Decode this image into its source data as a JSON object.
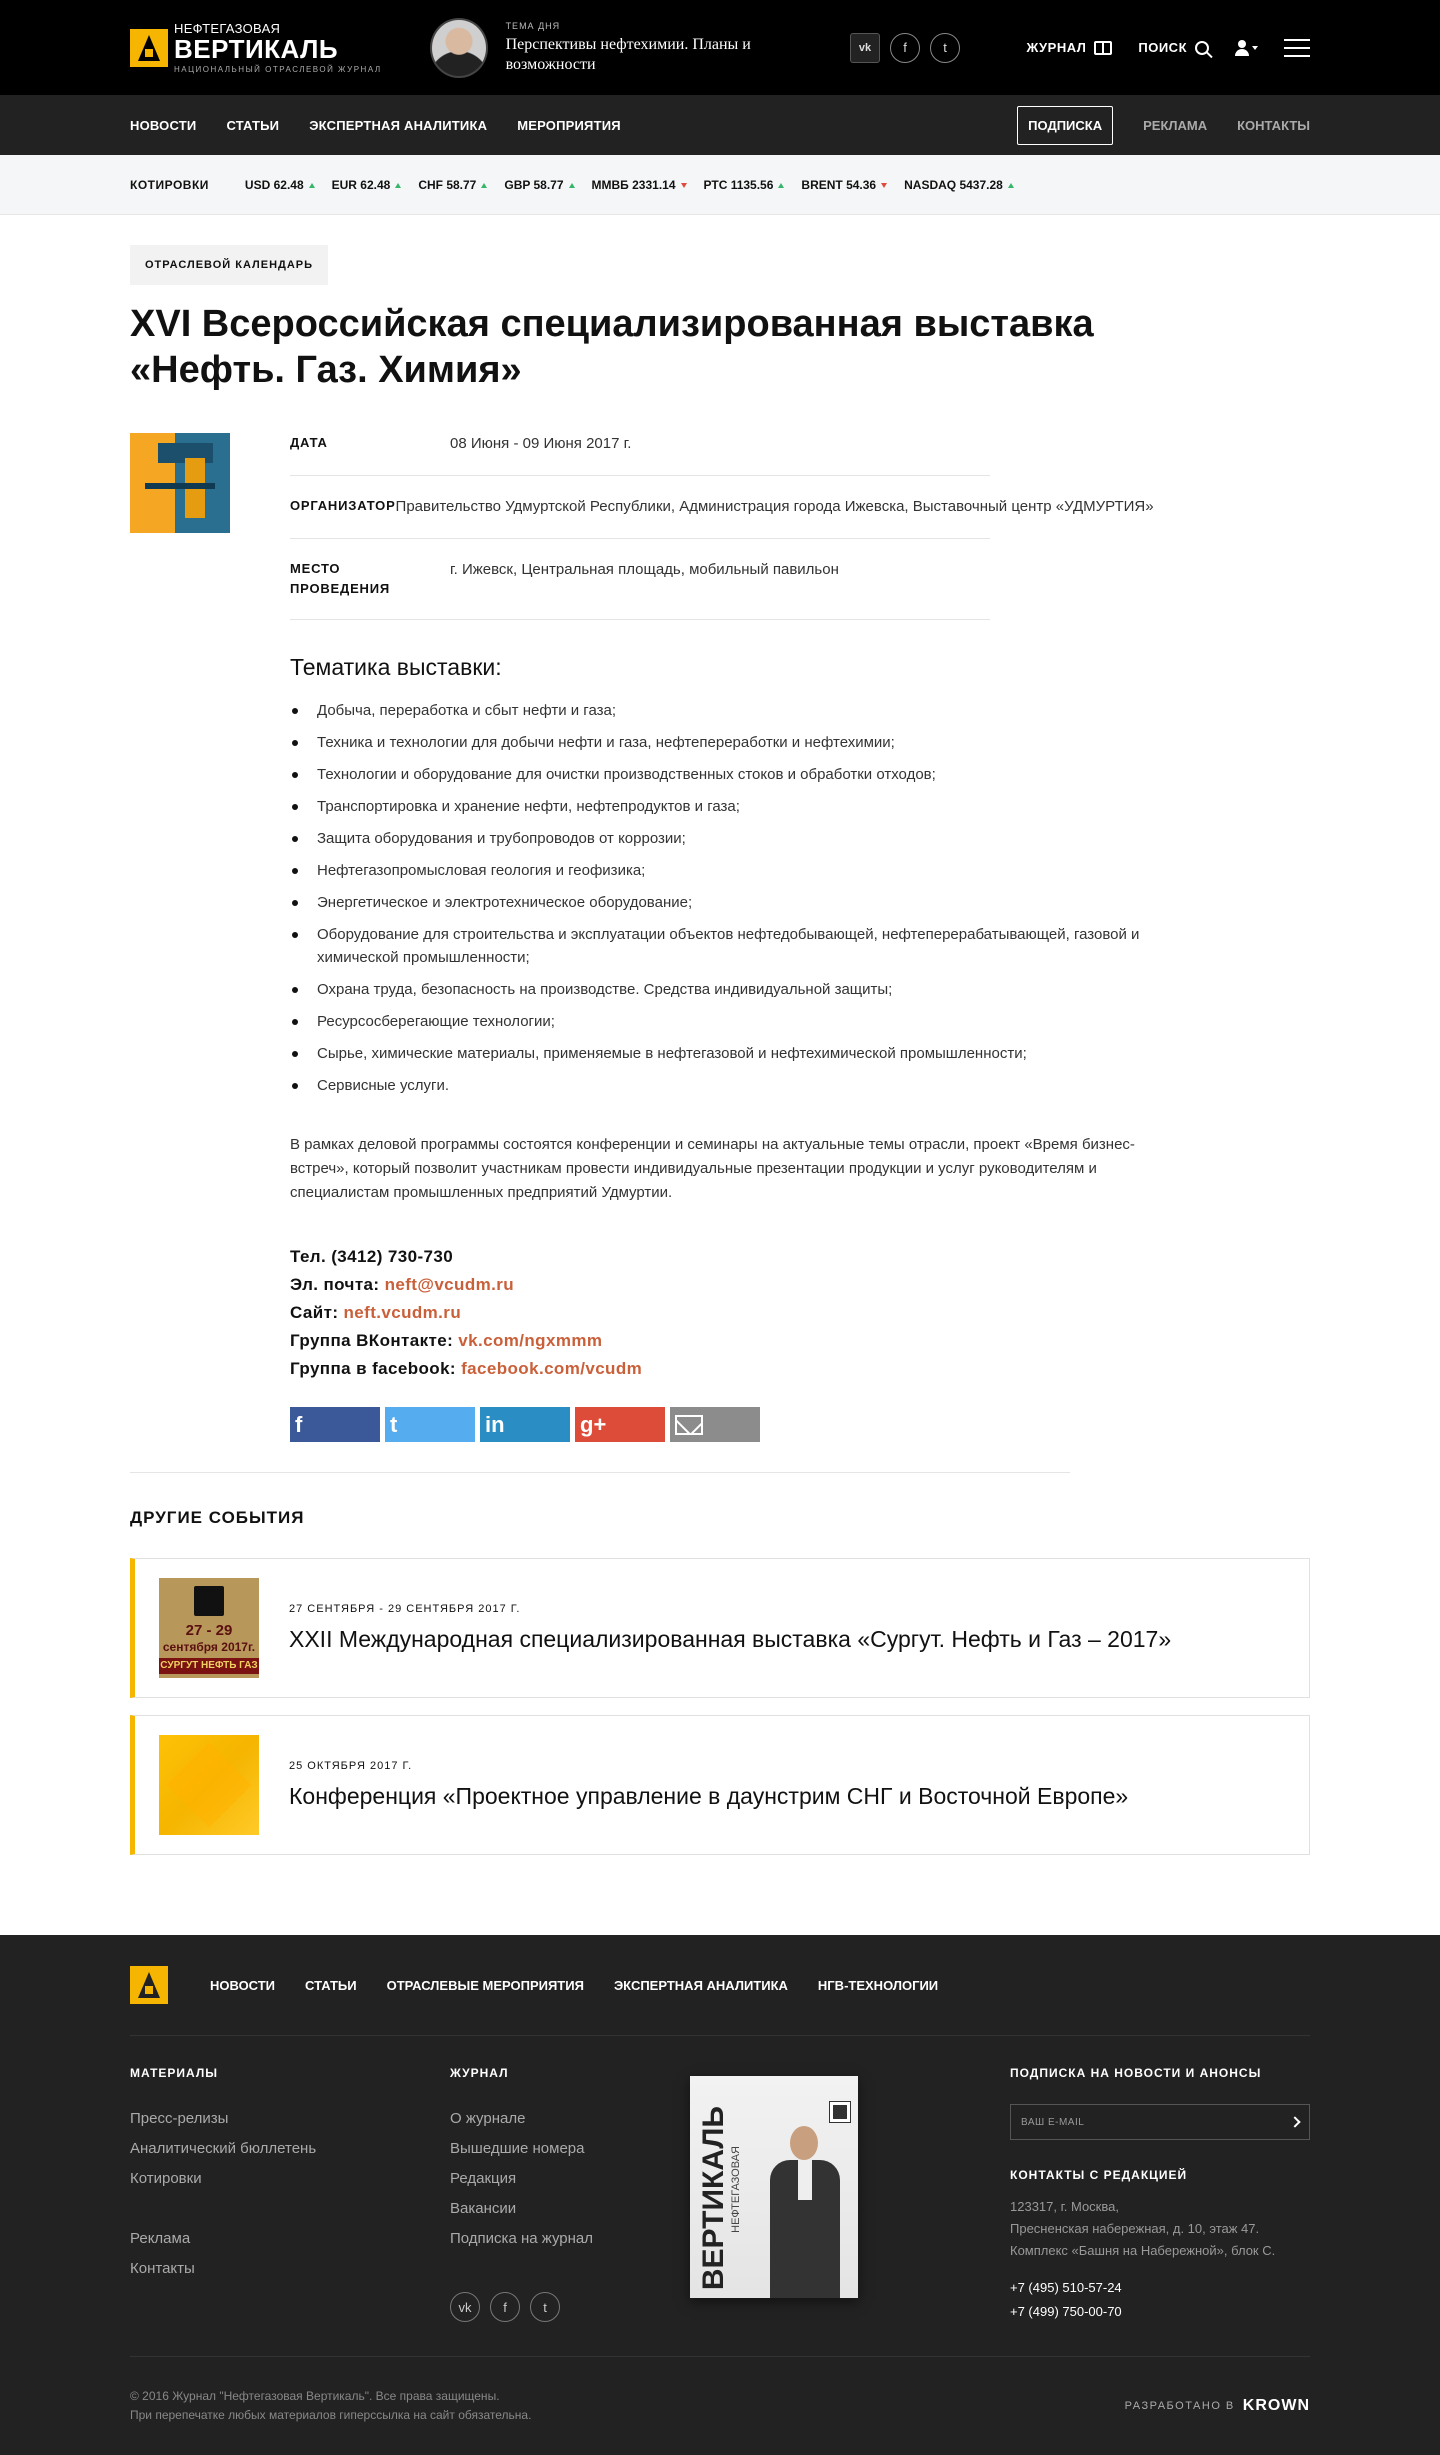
{
  "header": {
    "logo_line1": "НЕФТЕГАЗОВАЯ",
    "logo_line2": "ВЕРТИКАЛЬ",
    "logo_line3": "НАЦИОНАЛЬНЫЙ ОТРАСЛЕВОЙ ЖУРНАЛ",
    "topic_kicker": "ТЕМА ДНЯ",
    "topic_title": "Перспективы нефтехимии. Планы и возможности",
    "social": [
      "vk",
      "f",
      "t"
    ],
    "journal_label": "ЖУРНАЛ",
    "search_label": "ПОИСК"
  },
  "nav": {
    "items": [
      "НОВОСТИ",
      "СТАТЬИ",
      "ЭКСПЕРТНАЯ АНАЛИТИКА",
      "МЕРОПРИЯТИЯ"
    ],
    "subscribe": "ПОДПИСКА",
    "ads": "РЕКЛАМА",
    "contacts": "КОНТАКТЫ"
  },
  "quotes": {
    "label": "КОТИРОВКИ",
    "items": [
      {
        "text": "USD 62.48",
        "dir": "up"
      },
      {
        "text": "EUR 62.48",
        "dir": "up"
      },
      {
        "text": "CHF 58.77",
        "dir": "up"
      },
      {
        "text": "GBP 58.77",
        "dir": "up"
      },
      {
        "text": "ММВБ 2331.14",
        "dir": "down"
      },
      {
        "text": "РТС 1135.56",
        "dir": "up"
      },
      {
        "text": "BRENT 54.36",
        "dir": "down"
      },
      {
        "text": "NASDAQ 5437.28",
        "dir": "up"
      }
    ],
    "up_color": "#35b66a",
    "down_color": "#e04a3c"
  },
  "article": {
    "badge": "ОТРАСЛЕВОЙ КАЛЕНДАРЬ",
    "title": "XVI Всероссийская специализированная выставка «Нефть. Газ. Химия»",
    "meta": [
      {
        "key": "ДАТА",
        "value": "08 Июня - 09 Июня 2017 г."
      },
      {
        "key": "ОРГАНИЗАТОР",
        "value": "Правительство Удмуртской Республики, Администрация города Ижевска, Выставочный центр «УДМУРТИЯ»"
      },
      {
        "key": "МЕСТО ПРОВЕДЕНИЯ",
        "value": " г. Ижевск, Центральная площадь, мобильный павильон"
      }
    ],
    "topics_title": "Тематика выставки:",
    "topics": [
      "Добыча, переработка и сбыт нефти и газа;",
      "Техника и технологии для добычи нефти и газа, нефтепереработки и нефтехимии;",
      "Технологии и оборудование для очистки производственных стоков и обработки отходов;",
      "Транспортировка и хранение нефти, нефтепродуктов и газа;",
      "Защита оборудования и трубопроводов от коррозии;",
      "Нефтегазопромысловая геология и геофизика;",
      "Энергетическое и электротехническое оборудование;",
      "Оборудование для строительства и эксплуатации объектов нефтедобывающей, нефтеперерабатывающей, газовой и химической промышленности;",
      "Охрана труда, безопасность на производстве. Средства индивидуальной защиты;",
      "Ресурсосберегающие технологии;",
      "Сырье, химические материалы, применяемые в нефтегазовой и нефтехимической промышленности;",
      "Сервисные услуги."
    ],
    "description": "В рамках деловой программы состоятся конференции и семинары на актуальные темы отрасли, проект «Время бизнес-встреч», который позволит участникам провести индивидуальные презентации продукции и услуг руководителям и специалистам промышленных предприятий Удмуртии.",
    "contacts": {
      "phone": "Тел. (3412) 730-730",
      "email_label": "Эл. почта: ",
      "email": "neft@vcudm.ru",
      "site_label": "Сайт: ",
      "site": "neft.vcudm.ru",
      "vk_label": "Группа ВКонтакте: ",
      "vk": "vk.com/ngxmmm",
      "fb_label": "Группа в facebook: ",
      "fb": "facebook.com/vcudm"
    },
    "share": [
      "f",
      "t",
      "in",
      "g+"
    ]
  },
  "other": {
    "title": "ДРУГИЕ СОБЫТИЯ",
    "cards": [
      {
        "date": "27 СЕНТЯБРЯ - 29 СЕНТЯБРЯ 2017 Г.",
        "title": "XXII Международная специализированная выставка «Сургут. Нефть и Газ – 2017»",
        "img_line1": "27 - 29",
        "img_line2": "сентября 2017г.",
        "img_line3": "СУРГУТ НЕФТЬ ГАЗ"
      },
      {
        "date": "25 ОКТЯБРЯ 2017 Г.",
        "title": "Конференция «Проектное управление в даунстрим СНГ и Восточной Европе»"
      }
    ]
  },
  "footer": {
    "nav": [
      "НОВОСТИ",
      "СТАТЬИ",
      "ОТРАСЛЕВЫЕ МЕРОПРИЯТИЯ",
      "ЭКСПЕРТНАЯ АНАЛИТИКА",
      "НГВ-ТЕХНОЛОГИИ"
    ],
    "materials_title": "МАТЕРИАЛЫ",
    "materials": [
      "Пресс-релизы",
      "Аналитический бюллетень",
      "Котировки"
    ],
    "materials2": [
      "Реклама",
      "Контакты"
    ],
    "journal_title": "ЖУРНАЛ",
    "journal": [
      "О журнале",
      "Вышедшие номера",
      "Редакция",
      "Вакансии",
      "Подписка на журнал"
    ],
    "magazine_spine": "ВЕРТИКАЛЬ",
    "magazine_spine2": "НЕФТЕГАЗОВАЯ",
    "subscribe_title": "ПОДПИСКА НА НОВОСТИ И АНОНСЫ",
    "email_placeholder": "ВАШ E-MAIL",
    "contacts_title": "КОНТАКТЫ С РЕДАКЦИЕЙ",
    "address": [
      "123317, г. Москва,",
      "Пресненская набережная, д. 10, этаж 47.",
      "Комплекс «Башня на Набережной», блок С."
    ],
    "phones": [
      "+7 (495) 510-57-24",
      "+7 (499) 750-00-70"
    ],
    "copyright": "© 2016 Журнал \"Нефтегазовая Вертикаль\". Все права защищены.",
    "copyright2": "При перепечатке любых материалов гиперссылка на сайт обязательна.",
    "dev_label": "РАЗРАБОТАНО В",
    "dev_name": "KROWN"
  }
}
